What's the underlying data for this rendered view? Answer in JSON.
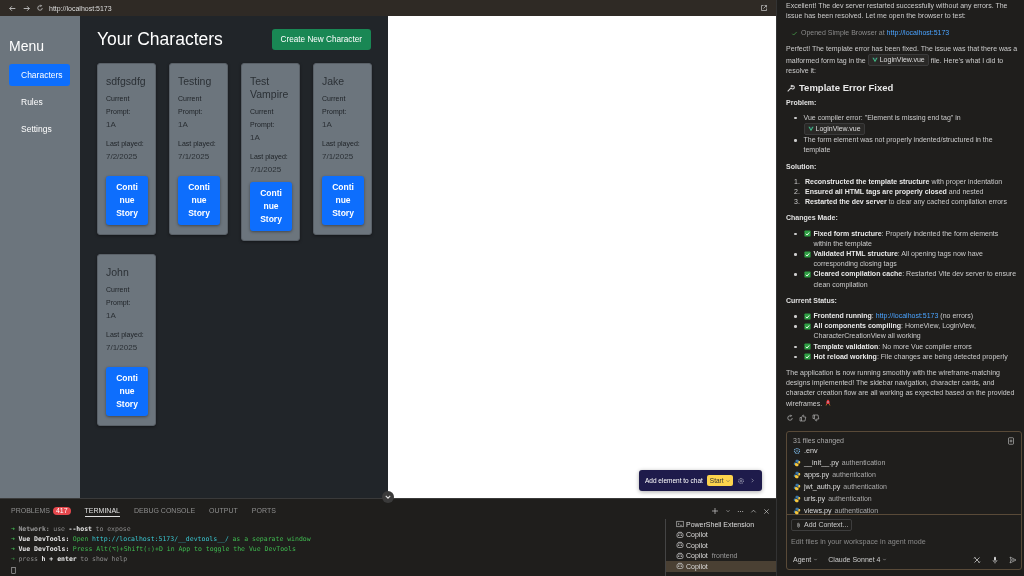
{
  "browser": {
    "url": "http://localhost:5173"
  },
  "app": {
    "menu_title": "Menu",
    "nav": [
      {
        "label": "Characters",
        "selected": true
      },
      {
        "label": "Rules",
        "selected": false
      },
      {
        "label": "Settings",
        "selected": false
      }
    ],
    "heading": "Your Characters",
    "create_button": "Create New Character",
    "characters": [
      {
        "name": "sdfgsdfg",
        "prompt_label": "Current Prompt:",
        "prompt": "1A",
        "played_label": "Last played:",
        "played": "7/2/2025",
        "button": "Continue Story"
      },
      {
        "name": "Testing",
        "prompt_label": "Current Prompt:",
        "prompt": "1A",
        "played_label": "Last played:",
        "played": "7/1/2025",
        "button": "Continue Story"
      },
      {
        "name": "Test Vampire",
        "prompt_label": "Current Prompt:",
        "prompt": "1A",
        "played_label": "Last played:",
        "played": "7/1/2025",
        "button": "Continue Story"
      },
      {
        "name": "Jake",
        "prompt_label": "Current Prompt:",
        "prompt": "1A",
        "played_label": "Last played:",
        "played": "7/1/2025",
        "button": "Continue Story"
      },
      {
        "name": "John",
        "prompt_label": "Current Prompt:",
        "prompt": "1A",
        "played_label": "Last played:",
        "played": "7/1/2025",
        "button": "Continue Story"
      }
    ]
  },
  "inspector": {
    "label": "Add element to chat",
    "start": "Start"
  },
  "panel": {
    "tabs": [
      {
        "label": "PROBLEMS",
        "badge": "417",
        "selected": false
      },
      {
        "label": "TERMINAL",
        "selected": true
      },
      {
        "label": "DEBUG CONSOLE",
        "selected": false
      },
      {
        "label": "OUTPUT",
        "selected": false
      },
      {
        "label": "PORTS",
        "selected": false
      }
    ],
    "lines": [
      [
        {
          "kind": "arrow",
          "text": "➜"
        },
        {
          "kind": "dimbold",
          "text": "Network:"
        },
        {
          "kind": "dim",
          "text": "use"
        },
        {
          "kind": "bold",
          "text": "--host"
        },
        {
          "kind": "dim",
          "text": "to expose"
        }
      ],
      [
        {
          "kind": "arrow",
          "text": "➜"
        },
        {
          "kind": "bold",
          "text": "Vue DevTools:"
        },
        {
          "kind": "green",
          "text": "Open"
        },
        {
          "kind": "cyan",
          "text": "http://localhost:5173/__devtools__/"
        },
        {
          "kind": "green",
          "text": "as a separate window"
        }
      ],
      [
        {
          "kind": "arrow",
          "text": "➜"
        },
        {
          "kind": "bold",
          "text": "Vue DevTools:"
        },
        {
          "kind": "green",
          "text": "Press Alt(⌥)+Shift(⇧)+D in App to toggle the Vue DevTools"
        }
      ],
      [
        {
          "kind": "dimarrow",
          "text": "➜"
        },
        {
          "kind": "dim",
          "text": "press"
        },
        {
          "kind": "bold",
          "text": "h + enter"
        },
        {
          "kind": "dim",
          "text": "to show help"
        }
      ]
    ],
    "terminals": [
      {
        "label": "PowerShell Extension",
        "kind": "shell",
        "selected": false
      },
      {
        "label": "Copilot",
        "kind": "copilot",
        "selected": false
      },
      {
        "label": "Copilot",
        "kind": "copilot",
        "selected": false
      },
      {
        "label": "Copilot",
        "detail": "frontend",
        "kind": "copilot",
        "selected": false
      },
      {
        "label": "Copilot",
        "kind": "copilot",
        "selected": true
      }
    ]
  },
  "chat": {
    "blocks": [
      {
        "kind": "paragraph",
        "parts": [
          {
            "kind": "text",
            "text": "Excellent! The dev server restarted successfully without any errors. The issue has been resolved. Let me open the browser to test:"
          }
        ]
      },
      {
        "kind": "tool",
        "parts": [
          {
            "kind": "text",
            "text": "Opened Simple Browser at"
          },
          {
            "kind": "link",
            "text": "http://localhost:5173"
          }
        ]
      },
      {
        "kind": "paragraph",
        "parts": [
          {
            "kind": "text",
            "text": "Perfect! The template error has been fixed. The issue was that there was a malformed form tag in the"
          },
          {
            "kind": "chip",
            "text": "LoginView.vue"
          },
          {
            "kind": "text",
            "text": "file. Here's what I did to resolve it:"
          }
        ]
      },
      {
        "kind": "heading",
        "text": "Template Error Fixed"
      },
      {
        "kind": "label",
        "text": "Problem:"
      },
      {
        "kind": "bullets",
        "items": [
          {
            "check": false,
            "parts": [
              {
                "kind": "text",
                "text": "Vue compiler error: \"Element is missing end tag\" in"
              },
              {
                "kind": "chip",
                "text": "LoginView.vue"
              }
            ]
          },
          {
            "check": false,
            "parts": [
              {
                "kind": "text",
                "text": "The form element was not properly indented/structured in the template"
              }
            ]
          }
        ]
      },
      {
        "kind": "label",
        "text": "Solution:"
      },
      {
        "kind": "numbered",
        "items": [
          {
            "number": "1.",
            "text": "**Reconstructed the template structure** with proper indentation"
          },
          {
            "number": "2.",
            "text": "**Ensured all HTML tags are properly closed** and nested"
          },
          {
            "number": "3.",
            "text": "**Restarted the dev server** to clear any cached compilation errors"
          }
        ]
      },
      {
        "kind": "label",
        "text": "Changes Made:"
      },
      {
        "kind": "bullets",
        "items": [
          {
            "check": true,
            "parts": [
              {
                "kind": "text",
                "text": "**Fixed form structure**: Properly indented the form elements within the template"
              }
            ]
          },
          {
            "check": true,
            "parts": [
              {
                "kind": "text",
                "text": "**Validated HTML structure**: All opening tags now have corresponding closing tags"
              }
            ]
          },
          {
            "check": true,
            "parts": [
              {
                "kind": "text",
                "text": "**Cleared compilation cache**: Restarted Vite dev server to ensure clean compilation"
              }
            ]
          }
        ]
      },
      {
        "kind": "label",
        "text": "Current Status:"
      },
      {
        "kind": "bullets",
        "items": [
          {
            "check": true,
            "parts": [
              {
                "kind": "text",
                "text": "**Frontend running**:"
              },
              {
                "kind": "link",
                "text": "http://localhost:5173"
              },
              {
                "kind": "text",
                "text": "(no errors)"
              }
            ]
          },
          {
            "check": true,
            "parts": [
              {
                "kind": "text",
                "text": "**All components compiling**: HomeView, LoginView, CharacterCreationView all working"
              }
            ]
          },
          {
            "check": true,
            "parts": [
              {
                "kind": "text",
                "text": "**Template validation**: No more Vue compiler errors"
              }
            ]
          },
          {
            "check": true,
            "parts": [
              {
                "kind": "text",
                "text": "**Hot reload working**: File changes are being detected properly"
              }
            ]
          }
        ]
      },
      {
        "kind": "paragraph",
        "parts": [
          {
            "kind": "text",
            "text": "The application is now running smoothly with the wireframe-matching designs implemented! The sidebar navigation, character cards, and character creation flow are all working as expected based on the provided wireframes."
          },
          {
            "kind": "icon"
          }
        ]
      },
      {
        "kind": "feedback"
      }
    ],
    "changes": {
      "summary": "31 files changed",
      "files": [
        {
          "name": ".env",
          "kind": "config"
        },
        {
          "name": "__init__.py",
          "folder": "authentication",
          "kind": "python"
        },
        {
          "name": "apps.py",
          "folder": "authentication",
          "kind": "python"
        },
        {
          "name": "jwt_auth.py",
          "folder": "authentication",
          "kind": "python"
        },
        {
          "name": "urls.py",
          "folder": "authentication",
          "kind": "python"
        },
        {
          "name": "views.py",
          "folder": "authentication",
          "kind": "python"
        }
      ]
    },
    "input": {
      "add_context": "Add Context...",
      "placeholder": "Edit files in your workspace in agent mode",
      "mode": "Agent",
      "model": "Claude Sonnet 4"
    }
  }
}
